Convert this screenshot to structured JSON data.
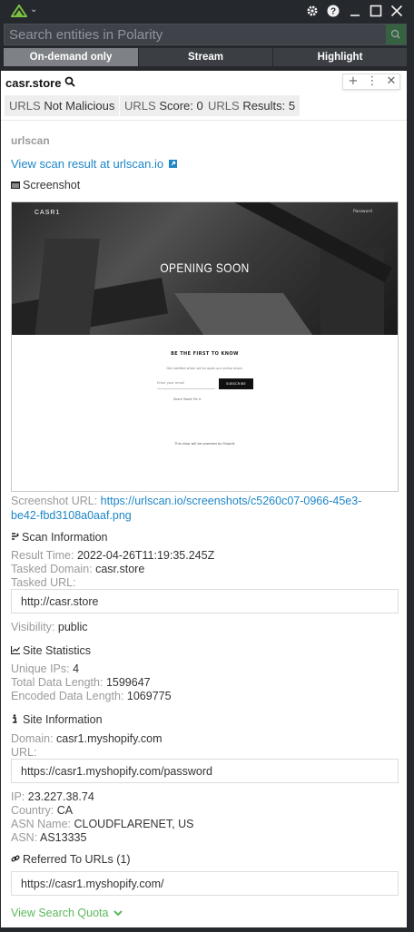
{
  "app": {
    "search_placeholder": "Search entities in Polarity",
    "tabs": [
      "On-demand only",
      "Stream",
      "Highlight"
    ],
    "active_tab": 0,
    "accent_color": "#6fbf3a"
  },
  "entity": {
    "name": "casr.store",
    "header_buttons": [
      "+",
      "⋮",
      "✕"
    ]
  },
  "tags": [
    {
      "label": "URLS",
      "value": "Not Malicious"
    },
    {
      "label": "URLS",
      "value": "Score: 0"
    },
    {
      "label": "URLS",
      "value": "Results: 5"
    }
  ],
  "details": {
    "integration": "urlscan",
    "view_link": "View scan result at urlscan.io",
    "screenshot_heading": "Screenshot",
    "screenshot_url_label": "Screenshot URL:",
    "screenshot_url_line1": "https://urlscan.io/screenshots/c5260c07-0966-45e3-",
    "screenshot_url_line2": "be42-fbd3108a0aaf.png",
    "scan_info_heading": "Scan Information",
    "result_time_label": "Result Time:",
    "result_time_value": "2022-04-26T11:19:35.245Z",
    "tasked_domain_label": "Tasked Domain:",
    "tasked_domain_value": "casr.store",
    "tasked_url_label": "Tasked URL:",
    "tasked_url_value": "http://casr.store",
    "visibility_label": "Visibility:",
    "visibility_value": "public",
    "site_stats_heading": "Site Statistics",
    "unique_ips_label": "Unique IPs:",
    "unique_ips_value": "4",
    "total_data_label": "Total Data Length:",
    "total_data_value": "1599647",
    "encoded_data_label": "Encoded Data Length:",
    "encoded_data_value": "1069775",
    "site_info_heading": "Site Information",
    "domain_label": "Domain:",
    "domain_value": "casr1.myshopify.com",
    "url_label": "URL:",
    "url_value": "https://casr1.myshopify.com/password",
    "ip_label": "IP:",
    "ip_value": "23.227.38.74",
    "country_label": "Country:",
    "country_value": "CA",
    "asn_name_label": "ASN Name:",
    "asn_name_value": "CLOUDFLARENET, US",
    "asn_label": "ASN:",
    "asn_value": "AS13335",
    "referred_heading": "Referred To URLs (1)",
    "referred_url": "https://casr1.myshopify.com/",
    "quota_link": "View Search Quota"
  },
  "screenshot_image": {
    "brand": "CASR1",
    "password_link": "Password",
    "hero_title": "OPENING SOON",
    "cta_title": "BE THE FIRST TO KNOW",
    "cta_sub": "Get notified when we've open our online store.",
    "email_placeholder": "Enter your email",
    "subscribe": "SUBSCRIBE",
    "share": "Share   Tweet   Pin it",
    "footer": "This shop will be powered by Shopify"
  }
}
